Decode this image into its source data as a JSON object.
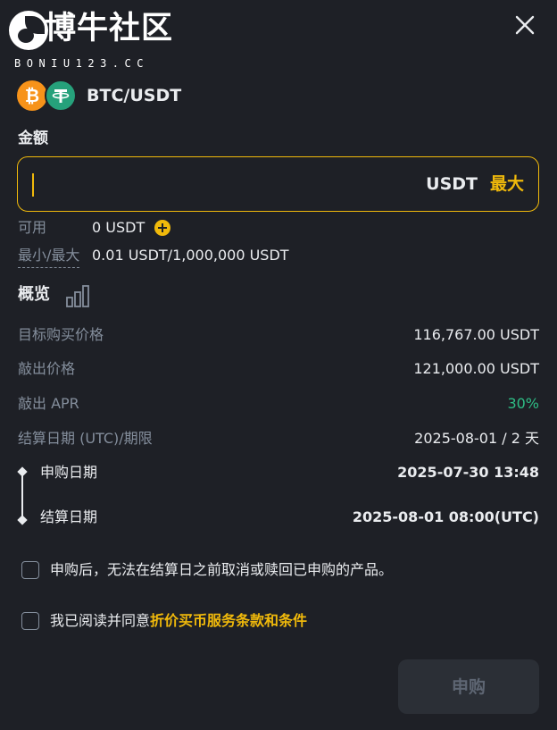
{
  "watermark": {
    "title": "博牛社区",
    "subtitle": "BONIU123.CC"
  },
  "close": {
    "icon": "close-icon"
  },
  "pair": {
    "base_icon": "btc-coin-icon",
    "base_symbol": "₿",
    "quote_icon": "usdt-tether-icon",
    "label": "BTC/USDT"
  },
  "amount": {
    "label": "金额",
    "value": "",
    "placeholder": "",
    "unit": "USDT",
    "max_label": "最大"
  },
  "balances": {
    "available_label": "可用",
    "available_value": "0 USDT",
    "available_add_icon": "plus-circle-icon",
    "minmax_label": "最小/最大",
    "minmax_value": "0.01 USDT/1,000,000 USDT"
  },
  "overview": {
    "title": "概览",
    "chart_icon": "bar-chart-icon",
    "rows": [
      {
        "label": "目标购买价格",
        "value": "116,767.00 USDT"
      },
      {
        "label": "敲出价格",
        "value": "121,000.00 USDT"
      },
      {
        "label": "敲出 APR",
        "value": "30%"
      },
      {
        "label": "结算日期 (UTC)/期限",
        "value": "2025-08-01 / 2 天"
      }
    ]
  },
  "timeline": {
    "subscribe_label": "申购日期",
    "subscribe_value": "2025-07-30 13:48",
    "settle_label": "结算日期",
    "settle_value": "2025-08-01 08:00(UTC)"
  },
  "agreements": {
    "notice_text": "申购后，无法在结算日之前取消或赎回已申购的产品。",
    "agree_prefix": "我已阅读并同意",
    "agree_link": "折价买币服务条款和条件",
    "notice_checked": false,
    "agree_checked": false
  },
  "submit": {
    "label": "申购"
  },
  "colors": {
    "background": "#1e2026",
    "accent": "#f0b90b",
    "positive": "#2ebd85",
    "muted_text": "#848e9c",
    "btc": "#f7931a",
    "usdt": "#26a17b"
  }
}
